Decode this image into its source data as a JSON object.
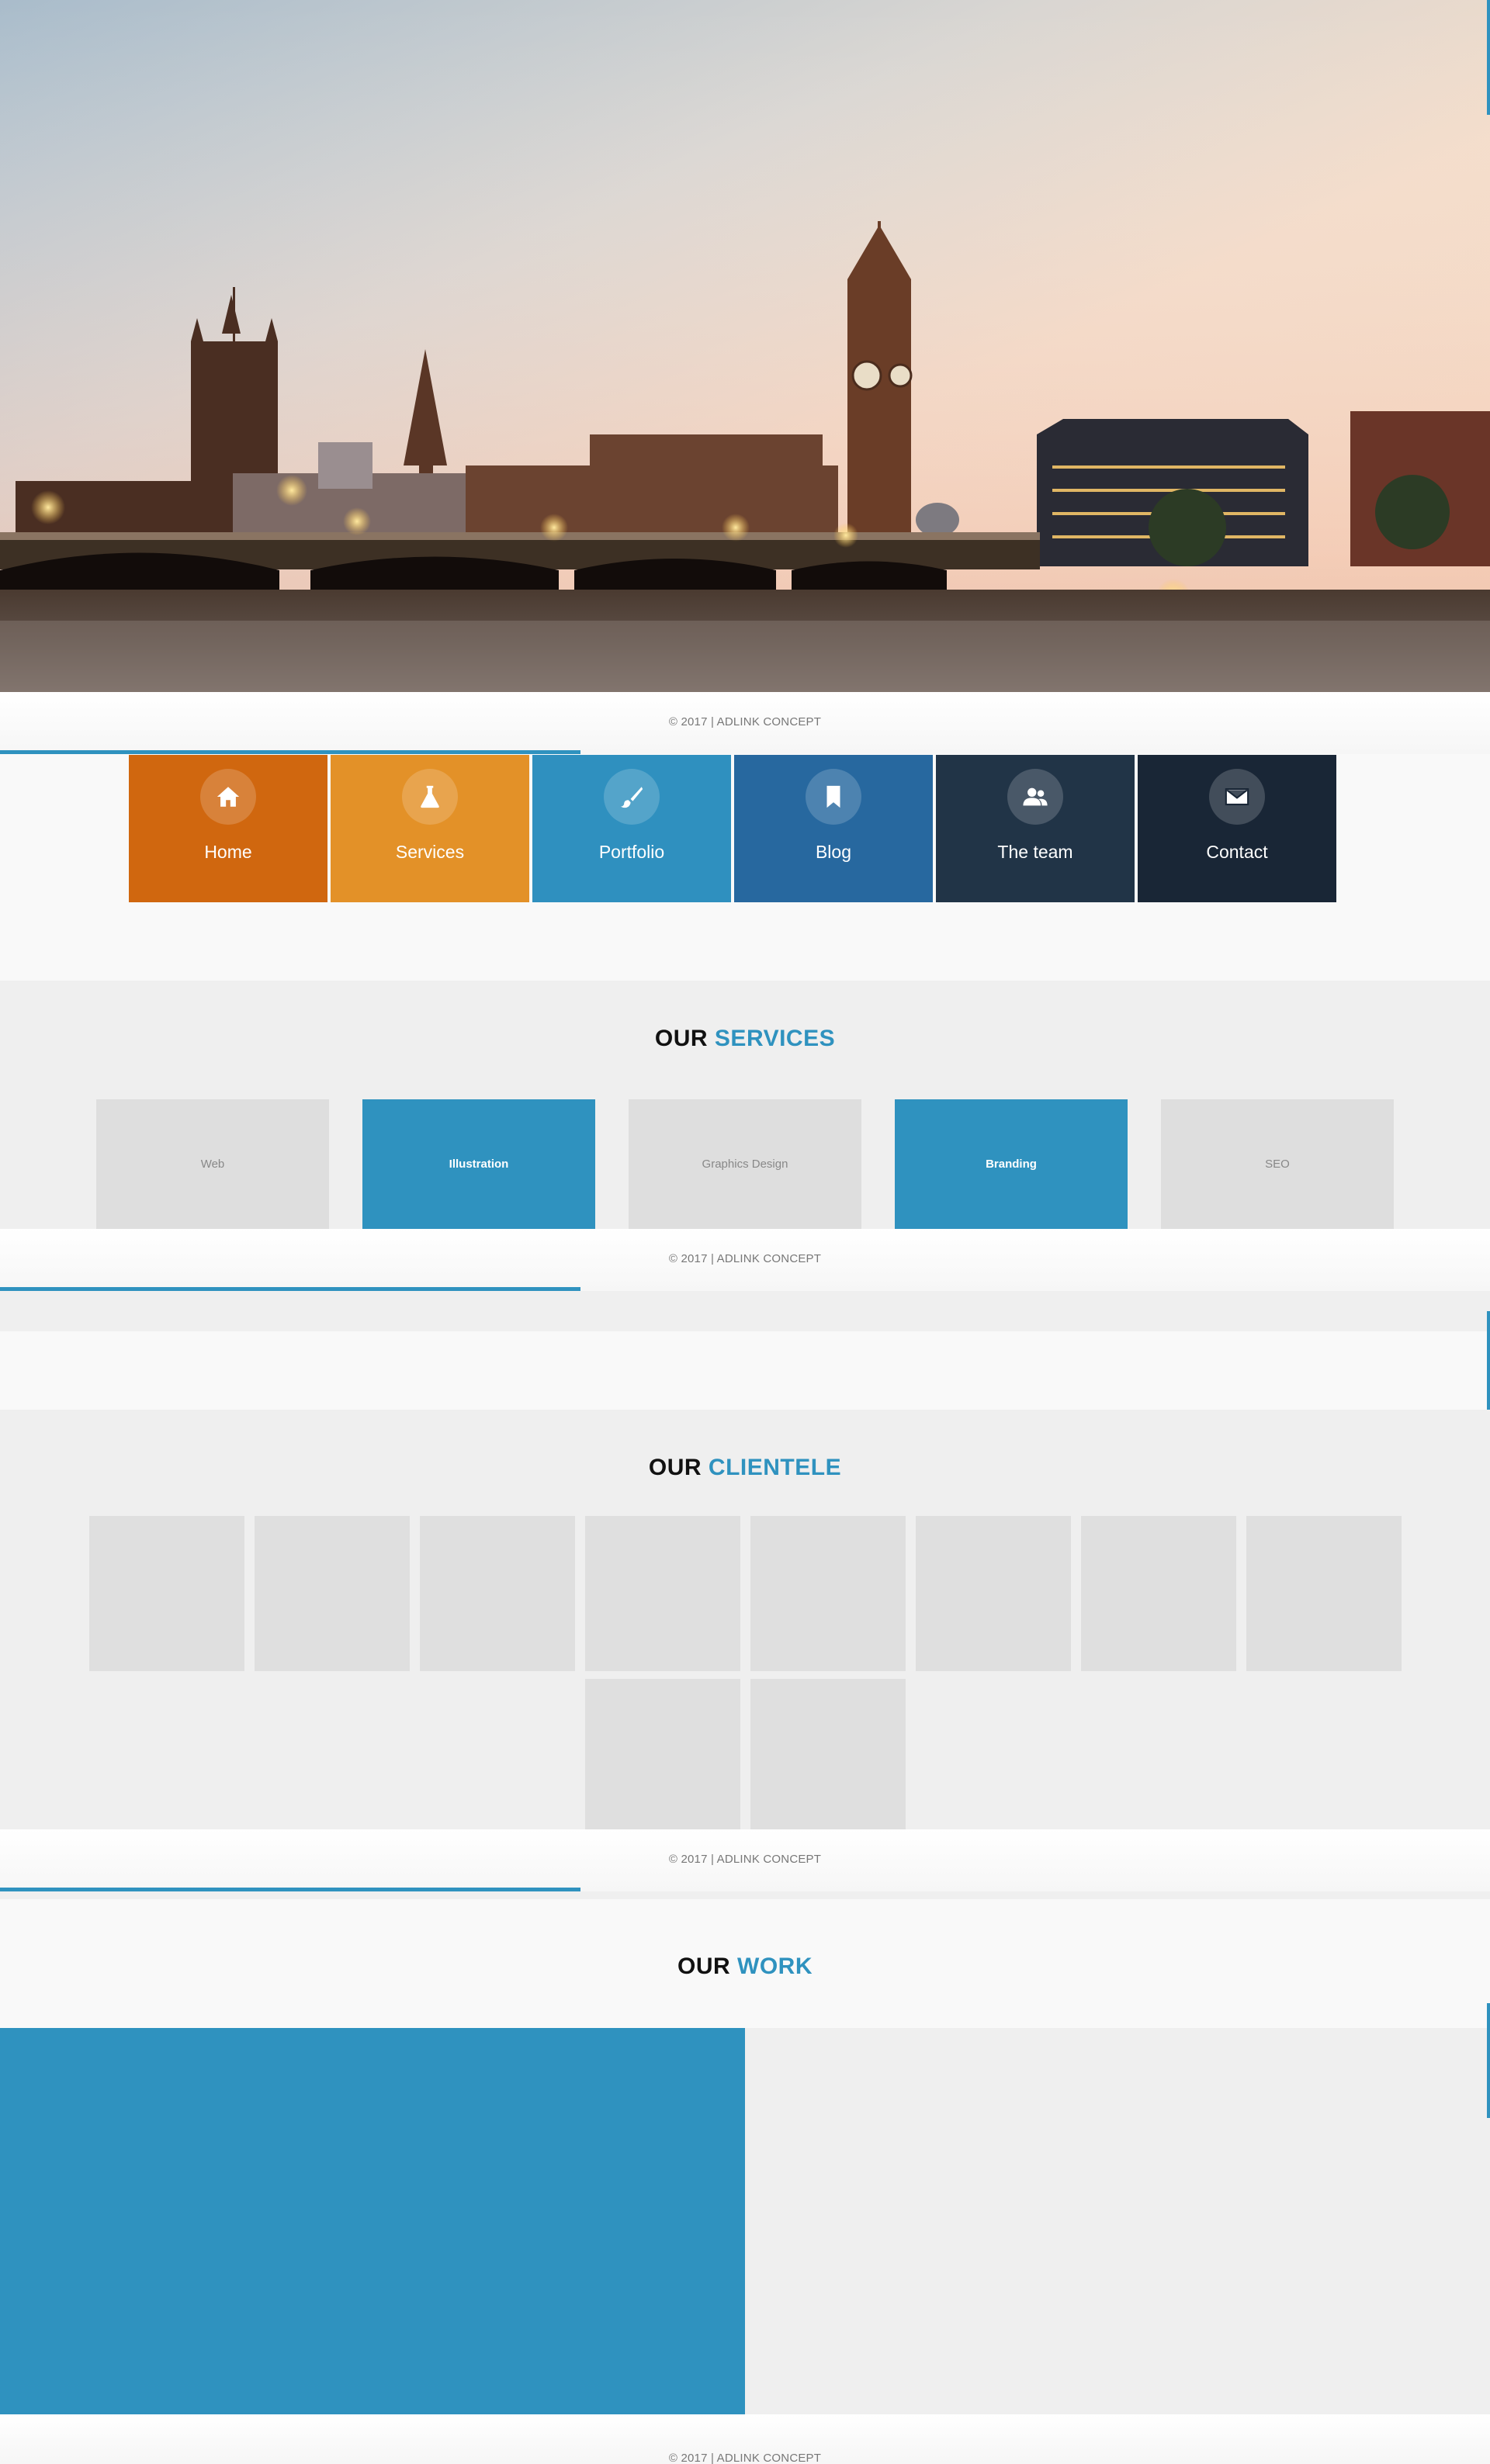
{
  "footer": {
    "copyright": "© 2017 | ADLINK CONCEPT"
  },
  "nav": {
    "items": [
      {
        "label": "Home",
        "icon": "home-icon",
        "color": "#d0670f"
      },
      {
        "label": "Services",
        "icon": "flask-icon",
        "color": "#e39128"
      },
      {
        "label": "Portfolio",
        "icon": "brush-icon",
        "color": "#2f90bf"
      },
      {
        "label": "Blog",
        "icon": "bookmark-icon",
        "color": "#27689f"
      },
      {
        "label": "The team",
        "icon": "team-icon",
        "color": "#213447"
      },
      {
        "label": "Contact",
        "icon": "envelope-icon",
        "color": "#192636"
      }
    ]
  },
  "services": {
    "title_plain": "OUR",
    "title_accent": "SERVICES",
    "items": [
      {
        "label": "Web",
        "active": false
      },
      {
        "label": "Illustration",
        "active": true
      },
      {
        "label": "Graphics Design",
        "active": false
      },
      {
        "label": "Branding",
        "active": true
      },
      {
        "label": "SEO",
        "active": false
      }
    ]
  },
  "clientele": {
    "title_plain": "OUR",
    "title_accent": "CLIENTELE",
    "logo_count": 10
  },
  "work": {
    "title_plain": "OUR",
    "title_accent": "WORK"
  },
  "colors": {
    "accent": "#2f92bf",
    "section_grey": "#efefef",
    "placeholder_grey": "#dedede"
  }
}
